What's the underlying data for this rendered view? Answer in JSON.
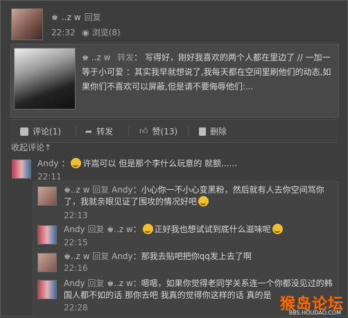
{
  "post": {
    "author": "..z w",
    "reply_label": "回复",
    "time": "22:32",
    "views": "浏览(8)"
  },
  "repost": {
    "author": "..z w",
    "action": "转发",
    "text": "写得好，刚好我喜欢的两个人都在里边了 // 一加一等于小可爱 ：其实我早就想说了,我每天都在空间里刷他们的动态,如果你们不喜欢可以屏蔽,但是请不要侮辱他们:..."
  },
  "actions": {
    "comment": "评论(1)",
    "forward": "转发",
    "like": "赞(13)",
    "delete": "删除"
  },
  "collapse_label": "收起评论↑",
  "comments": [
    {
      "author": "Andy",
      "text": "许嵩可以 但是那个李什么玩意的 就额......",
      "time": "22:11"
    }
  ],
  "replies": [
    {
      "author": "..z w",
      "reply": "回复",
      "to": "Andy",
      "text": "小心你一不小心变黑粉，然后就有人去你空间骂你了，我就亲眼见证了围攻的情况好吧",
      "time": "22:13"
    },
    {
      "author": "Andy",
      "reply": "回复",
      "to": "..z w",
      "text": "正好我也想试试到底什么滋味呢",
      "time": "22:15"
    },
    {
      "author": "..z w",
      "reply": "回复",
      "to": "Andy",
      "text": "那我去贴吧把你qq发上去了啊",
      "time": "22:16"
    },
    {
      "author": "Andy",
      "reply": "回复",
      "to": "..z w",
      "text": "嗯嗯，如果你觉得老同学关系连一个你都没见过的韩国人都不如的话 那你去吧 我真的觉得你这样的话 真的是",
      "time": "22:28"
    }
  ],
  "watermark": {
    "main": "猴岛论坛",
    "sub": "BBS.HOUDAO.COM"
  }
}
